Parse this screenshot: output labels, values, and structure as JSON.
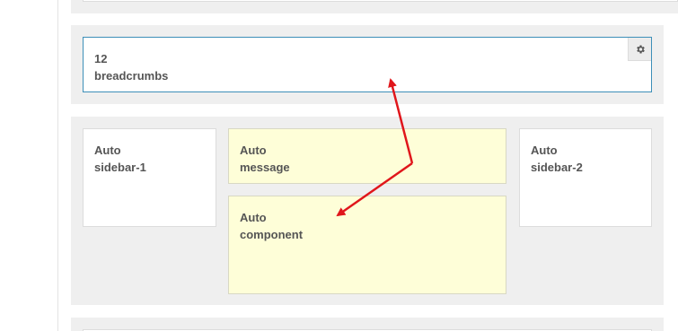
{
  "layout_rows": {
    "breadcrumbs_block": {
      "span": "12",
      "position": "breadcrumbs",
      "settings_icon": "gear-icon"
    },
    "main_row": {
      "sidebar_1": {
        "span": "Auto",
        "position": "sidebar-1"
      },
      "message": {
        "span": "Auto",
        "position": "message"
      },
      "component": {
        "span": "Auto",
        "position": "component"
      },
      "sidebar_2": {
        "span": "Auto",
        "position": "sidebar-2"
      }
    }
  },
  "colors": {
    "row_background": "#efefef",
    "highlight_yellow": "#fefed8",
    "selected_border": "#3d8fb8",
    "annotation_arrow": "#e0161b"
  }
}
